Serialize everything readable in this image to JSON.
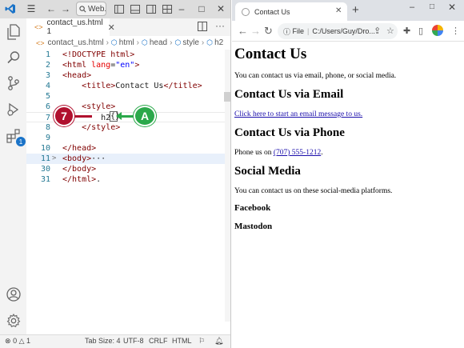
{
  "vscode": {
    "search_label": "Web...",
    "tab": {
      "label": "contact_us.html 1"
    },
    "breadcrumbs": [
      "contact_us.html",
      "html",
      "head",
      "style",
      "h2"
    ],
    "activity": {
      "extensions_badge": "1"
    },
    "code_lines": [
      {
        "num": "1",
        "fold": "",
        "segments": [
          [
            "tag",
            "<!DOCTYPE html>"
          ]
        ]
      },
      {
        "num": "2",
        "fold": "",
        "segments": [
          [
            "tag",
            "<html "
          ],
          [
            "attr",
            "lang"
          ],
          [
            "plain",
            "="
          ],
          [
            "str",
            "\"en\""
          ],
          [
            "tag",
            ">"
          ]
        ]
      },
      {
        "num": "3",
        "fold": "",
        "segments": [
          [
            "tag",
            "<head>"
          ]
        ]
      },
      {
        "num": "4",
        "fold": "",
        "segments": [
          [
            "plain",
            "    "
          ],
          [
            "tag",
            "<title>"
          ],
          [
            "plain",
            "Contact Us"
          ],
          [
            "tag",
            "</title>"
          ]
        ]
      },
      {
        "num": "5",
        "fold": "",
        "segments": []
      },
      {
        "num": "6",
        "fold": "",
        "segments": [
          [
            "plain",
            "    "
          ],
          [
            "tag",
            "<style>"
          ]
        ]
      },
      {
        "num": "7",
        "fold": "",
        "segments": [
          [
            "plain",
            "        h2 "
          ]
        ]
      },
      {
        "num": "8",
        "fold": "",
        "segments": [
          [
            "plain",
            "    "
          ],
          [
            "tag",
            "</style>"
          ]
        ]
      },
      {
        "num": "9",
        "fold": "",
        "segments": []
      },
      {
        "num": "10",
        "fold": "",
        "segments": [
          [
            "tag",
            "</head>"
          ]
        ]
      },
      {
        "num": "11",
        "fold": ">",
        "segments": [
          [
            "tag",
            "<body>"
          ],
          [
            "plain",
            "···"
          ]
        ]
      },
      {
        "num": "30",
        "fold": "",
        "segments": [
          [
            "tag",
            "</body>"
          ]
        ]
      },
      {
        "num": "31",
        "fold": "",
        "segments": [
          [
            "tag",
            "</html>"
          ],
          [
            "plain",
            "."
          ]
        ]
      }
    ],
    "cursor_brace": "{}",
    "status": {
      "errors": "0",
      "warnings": "1",
      "tab_size": "Tab Size: 4",
      "encoding": "UTF-8",
      "eol": "CRLF",
      "language": "HTML"
    }
  },
  "callouts": {
    "step": "7",
    "marker": "A"
  },
  "browser": {
    "tab_title": "Contact Us",
    "address_scheme": "File",
    "address_path": "C:/Users/Guy/Dro...",
    "page": {
      "h1": "Contact Us",
      "intro": "You can contact us via email, phone, or social media.",
      "email_heading": "Contact Us via Email",
      "email_link": "Click here to start an email message to us.",
      "phone_heading": "Contact Us via Phone",
      "phone_prefix": "Phone us on ",
      "phone_number": "(707) 555-1212",
      "phone_suffix": ".",
      "social_heading": "Social Media",
      "social_text": "You can contact us on these social-media platforms.",
      "facebook": "Facebook",
      "mastodon": "Mastodon"
    }
  },
  "colors": {
    "callout_step": "#b0102e",
    "callout_marker": "#2aa84a",
    "vscode_accent": "#1a73c8",
    "link": "#1a0dab"
  }
}
